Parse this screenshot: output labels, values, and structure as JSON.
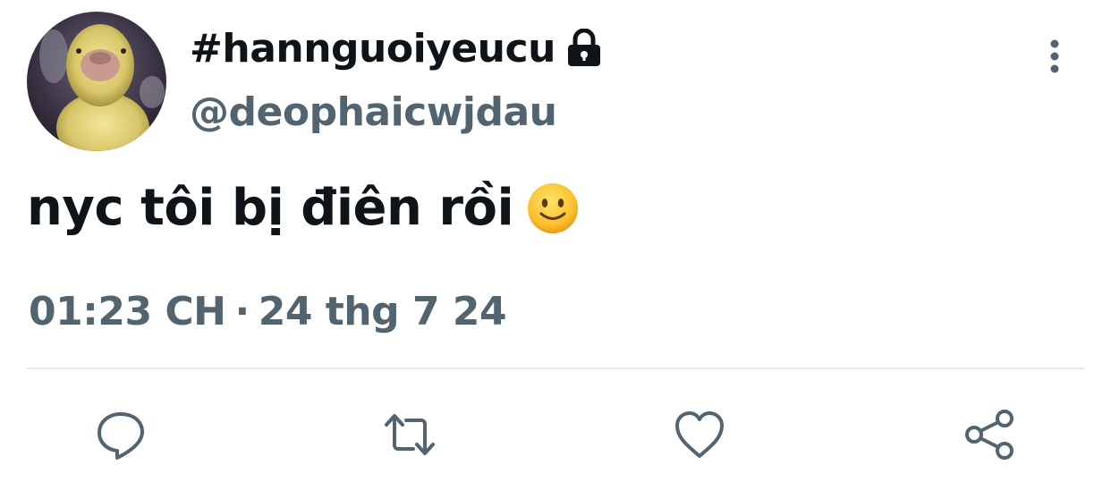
{
  "tweet": {
    "display_name": "#hannguoiyeucu",
    "handle": "@deophaicwjdau",
    "text": "nyc tôi bị điên rồi",
    "time": "01:23 CH",
    "separator": "·",
    "date": "24 thg 7 24"
  },
  "icons": {
    "lock": "lock-icon",
    "more": "more-vertical-icon",
    "emoji": "slightly-smiling-face-emoji",
    "reply": "reply-icon",
    "retweet": "retweet-icon",
    "like": "heart-icon",
    "share": "share-icon"
  },
  "colors": {
    "primary_text": "#0f1419",
    "secondary_text": "#536471",
    "divider": "#e7e9ea",
    "icon": "#536471"
  }
}
